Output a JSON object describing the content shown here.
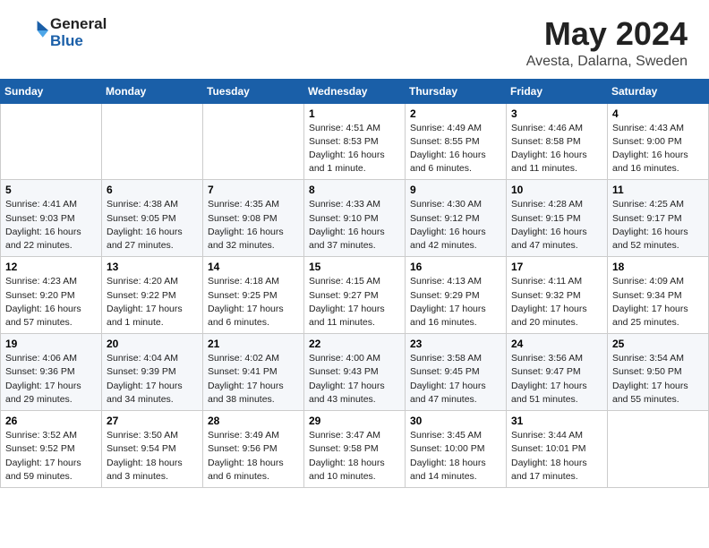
{
  "header": {
    "logo_line1": "General",
    "logo_line2": "Blue",
    "month": "May 2024",
    "location": "Avesta, Dalarna, Sweden"
  },
  "weekdays": [
    "Sunday",
    "Monday",
    "Tuesday",
    "Wednesday",
    "Thursday",
    "Friday",
    "Saturday"
  ],
  "weeks": [
    [
      null,
      null,
      null,
      {
        "day": 1,
        "sunrise": "4:51 AM",
        "sunset": "8:53 PM",
        "daylight": "16 hours and 1 minute."
      },
      {
        "day": 2,
        "sunrise": "4:49 AM",
        "sunset": "8:55 PM",
        "daylight": "16 hours and 6 minutes."
      },
      {
        "day": 3,
        "sunrise": "4:46 AM",
        "sunset": "8:58 PM",
        "daylight": "16 hours and 11 minutes."
      },
      {
        "day": 4,
        "sunrise": "4:43 AM",
        "sunset": "9:00 PM",
        "daylight": "16 hours and 16 minutes."
      }
    ],
    [
      {
        "day": 5,
        "sunrise": "4:41 AM",
        "sunset": "9:03 PM",
        "daylight": "16 hours and 22 minutes."
      },
      {
        "day": 6,
        "sunrise": "4:38 AM",
        "sunset": "9:05 PM",
        "daylight": "16 hours and 27 minutes."
      },
      {
        "day": 7,
        "sunrise": "4:35 AM",
        "sunset": "9:08 PM",
        "daylight": "16 hours and 32 minutes."
      },
      {
        "day": 8,
        "sunrise": "4:33 AM",
        "sunset": "9:10 PM",
        "daylight": "16 hours and 37 minutes."
      },
      {
        "day": 9,
        "sunrise": "4:30 AM",
        "sunset": "9:12 PM",
        "daylight": "16 hours and 42 minutes."
      },
      {
        "day": 10,
        "sunrise": "4:28 AM",
        "sunset": "9:15 PM",
        "daylight": "16 hours and 47 minutes."
      },
      {
        "day": 11,
        "sunrise": "4:25 AM",
        "sunset": "9:17 PM",
        "daylight": "16 hours and 52 minutes."
      }
    ],
    [
      {
        "day": 12,
        "sunrise": "4:23 AM",
        "sunset": "9:20 PM",
        "daylight": "16 hours and 57 minutes."
      },
      {
        "day": 13,
        "sunrise": "4:20 AM",
        "sunset": "9:22 PM",
        "daylight": "17 hours and 1 minute."
      },
      {
        "day": 14,
        "sunrise": "4:18 AM",
        "sunset": "9:25 PM",
        "daylight": "17 hours and 6 minutes."
      },
      {
        "day": 15,
        "sunrise": "4:15 AM",
        "sunset": "9:27 PM",
        "daylight": "17 hours and 11 minutes."
      },
      {
        "day": 16,
        "sunrise": "4:13 AM",
        "sunset": "9:29 PM",
        "daylight": "17 hours and 16 minutes."
      },
      {
        "day": 17,
        "sunrise": "4:11 AM",
        "sunset": "9:32 PM",
        "daylight": "17 hours and 20 minutes."
      },
      {
        "day": 18,
        "sunrise": "4:09 AM",
        "sunset": "9:34 PM",
        "daylight": "17 hours and 25 minutes."
      }
    ],
    [
      {
        "day": 19,
        "sunrise": "4:06 AM",
        "sunset": "9:36 PM",
        "daylight": "17 hours and 29 minutes."
      },
      {
        "day": 20,
        "sunrise": "4:04 AM",
        "sunset": "9:39 PM",
        "daylight": "17 hours and 34 minutes."
      },
      {
        "day": 21,
        "sunrise": "4:02 AM",
        "sunset": "9:41 PM",
        "daylight": "17 hours and 38 minutes."
      },
      {
        "day": 22,
        "sunrise": "4:00 AM",
        "sunset": "9:43 PM",
        "daylight": "17 hours and 43 minutes."
      },
      {
        "day": 23,
        "sunrise": "3:58 AM",
        "sunset": "9:45 PM",
        "daylight": "17 hours and 47 minutes."
      },
      {
        "day": 24,
        "sunrise": "3:56 AM",
        "sunset": "9:47 PM",
        "daylight": "17 hours and 51 minutes."
      },
      {
        "day": 25,
        "sunrise": "3:54 AM",
        "sunset": "9:50 PM",
        "daylight": "17 hours and 55 minutes."
      }
    ],
    [
      {
        "day": 26,
        "sunrise": "3:52 AM",
        "sunset": "9:52 PM",
        "daylight": "17 hours and 59 minutes."
      },
      {
        "day": 27,
        "sunrise": "3:50 AM",
        "sunset": "9:54 PM",
        "daylight": "18 hours and 3 minutes."
      },
      {
        "day": 28,
        "sunrise": "3:49 AM",
        "sunset": "9:56 PM",
        "daylight": "18 hours and 6 minutes."
      },
      {
        "day": 29,
        "sunrise": "3:47 AM",
        "sunset": "9:58 PM",
        "daylight": "18 hours and 10 minutes."
      },
      {
        "day": 30,
        "sunrise": "3:45 AM",
        "sunset": "10:00 PM",
        "daylight": "18 hours and 14 minutes."
      },
      {
        "day": 31,
        "sunrise": "3:44 AM",
        "sunset": "10:01 PM",
        "daylight": "18 hours and 17 minutes."
      },
      null
    ]
  ],
  "labels": {
    "sunrise": "Sunrise:",
    "sunset": "Sunset:",
    "daylight": "Daylight:"
  }
}
